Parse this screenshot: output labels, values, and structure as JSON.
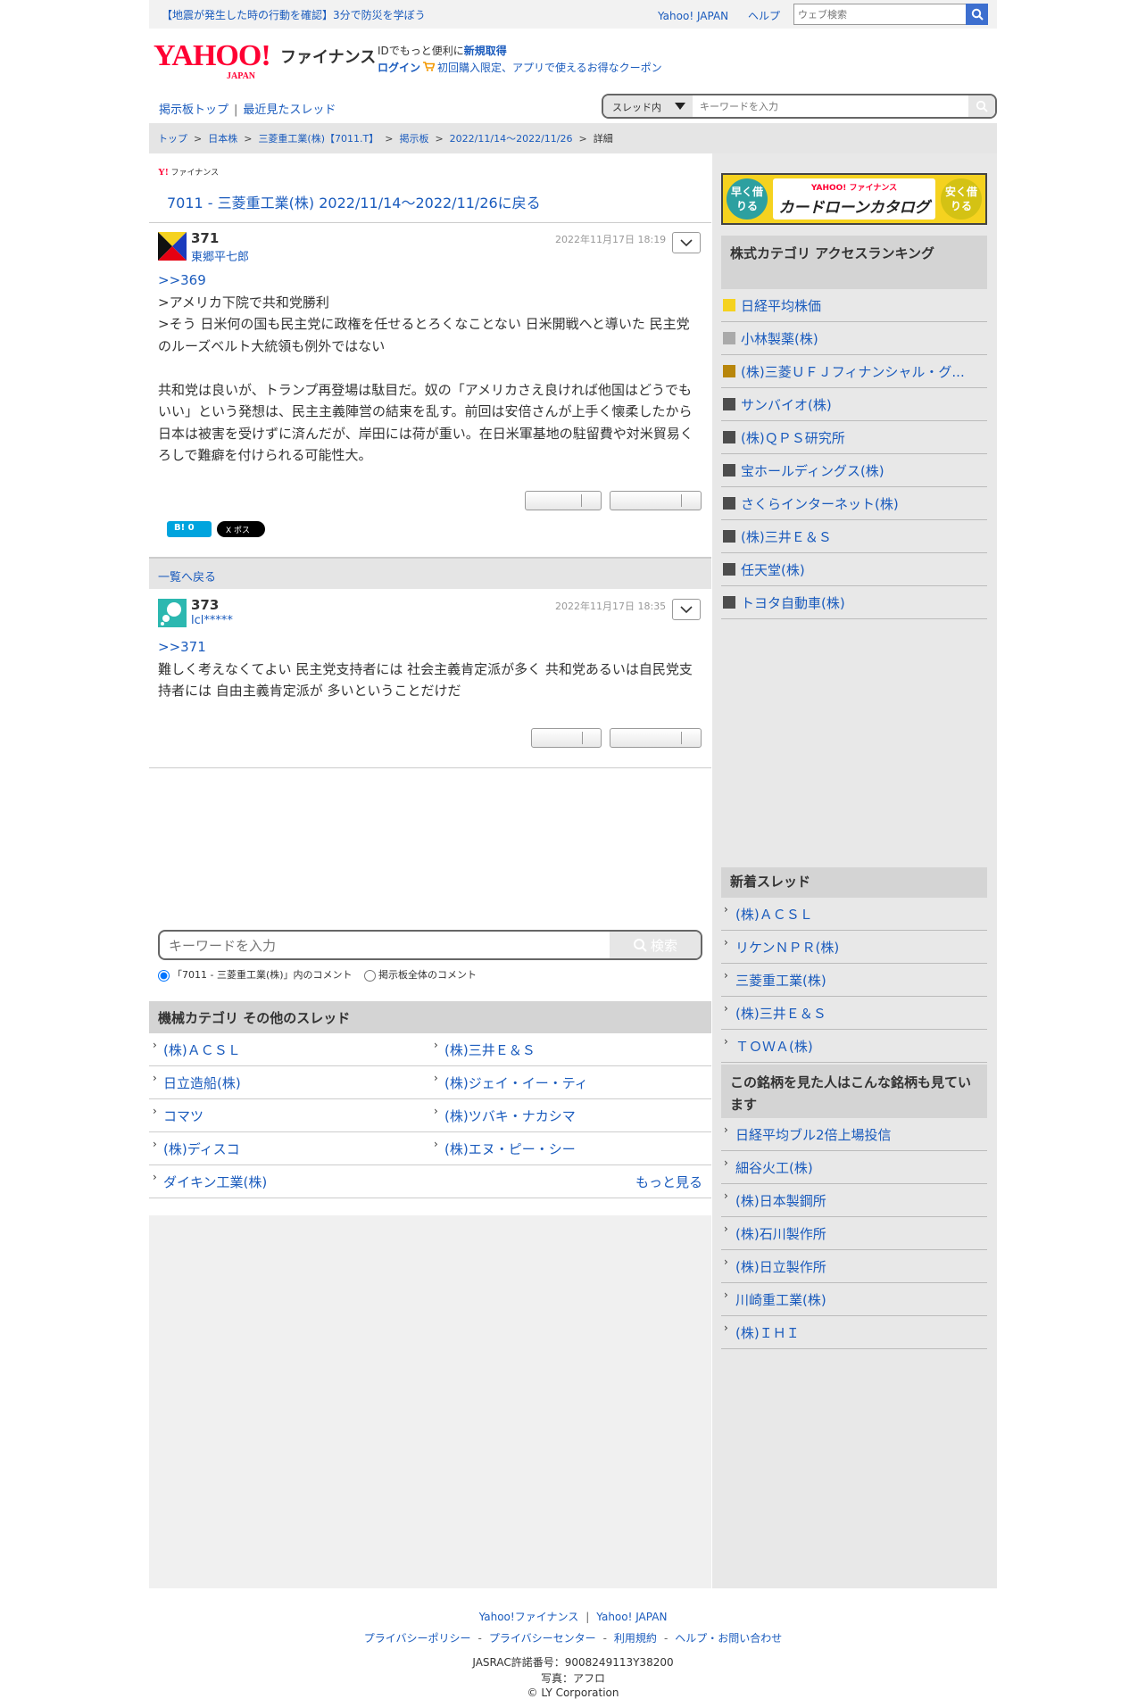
{
  "topbar": {
    "notice": "【地震が発生した時の行動を確認】3分で防災を学ぼう",
    "yahoo_japan": "Yahoo! JAPAN",
    "help": "ヘルプ",
    "search_placeholder": "ウェブ検索"
  },
  "header": {
    "logo_text": "YAHOO!",
    "logo_sub": "JAPAN",
    "service_name": "ファイナンス",
    "id_line_prefix": "IDでもっと便利に",
    "register": "新規取得",
    "login": "ログイン",
    "coupon": "初回購入限定、アプリで使えるお得なクーポン"
  },
  "nav": {
    "board_top": "掲示板トップ",
    "recent": "最近見たスレッド",
    "scope_select": "スレッド内",
    "keyword_placeholder": "キーワードを入力"
  },
  "breadcrumb": [
    "トップ",
    "日本株",
    "三菱重工業(株)【7011.T】",
    "掲示板",
    "2022/11/14〜2022/11/26",
    "詳細"
  ],
  "thread": {
    "source": "ファイナンス",
    "back_link": "7011 - 三菱重工業(株) 2022/11/14〜2022/11/26に戻る"
  },
  "posts": [
    {
      "number": "371",
      "user": "東郷平七郎",
      "date": "2022年11月17日 18:19",
      "ref": ">>369",
      "lines": [
        ">アメリカ下院で共和党勝利",
        ">そう 日米何の国も民主党に政権を任せるとろくなことない 日米開戦へと導いた 民主党のルーズベルト大統領も例外ではない",
        "",
        "共和党は良いが、トランプ再登場は駄目だ。奴の「アメリカさえ良ければ他国はどうでもいい」という発想は、民主主義陣営の結束を乱す。前回は安倍さんが上手く懐柔したから日本は被害を受けずに済んだが、岸田には荷が重い。在日米軍基地の駐留費や対米貿易くろしで難癖を付けられる可能性大。"
      ]
    },
    {
      "number": "373",
      "user": "lcl*****",
      "date": "2022年11月17日 18:35",
      "ref": ">>371",
      "lines": [
        "難しく考えなくてよい 民主党支持者には 社会主義肯定派が多く 共和党あるいは自民党支持者には 自由主義肯定派が 多いということだけだ"
      ]
    }
  ],
  "share": {
    "hatena": "B! 0",
    "x": "X ポスト"
  },
  "list_back": "一覧へ戻る",
  "bottom_search": {
    "placeholder": "キーワードを入力",
    "button": "検索",
    "radio_thread": "「7011 - 三菱重工業(株)」内のコメント",
    "radio_all": "掲示板全体のコメント"
  },
  "other_threads": {
    "title": "機械カテゴリ その他のスレッド",
    "items": [
      "(株)ＡＣＳＬ",
      "(株)三井Ｅ＆Ｓ",
      "日立造船(株)",
      "(株)ジェイ・イー・ティ",
      "コマツ",
      "(株)ツバキ・ナカシマ",
      "(株)ディスコ",
      "(株)エヌ・ピー・シー",
      "ダイキン工業(株)"
    ],
    "more": "もっと見る"
  },
  "sidebar": {
    "ad": {
      "left": "早く借りる",
      "brand": "YAHOO! ファイナンス",
      "title": "カードローンカタログ",
      "right": "安く借りる"
    },
    "ranking_title": "株式カテゴリ アクセスランキング",
    "ranking": [
      {
        "name": "日経平均株価",
        "color": "#f5d21f"
      },
      {
        "name": "小林製薬(株)",
        "color": "#aaaaaa"
      },
      {
        "name": "(株)三菱ＵＦＪフィナンシャル・グ...",
        "color": "#b8860b"
      },
      {
        "name": "サンバイオ(株)",
        "color": "#4d4d4d"
      },
      {
        "name": "(株)ＱＰＳ研究所",
        "color": "#4d4d4d"
      },
      {
        "name": "宝ホールディングス(株)",
        "color": "#4d4d4d"
      },
      {
        "name": "さくらインターネット(株)",
        "color": "#4d4d4d"
      },
      {
        "name": "(株)三井Ｅ＆Ｓ",
        "color": "#4d4d4d"
      },
      {
        "name": "任天堂(株)",
        "color": "#4d4d4d"
      },
      {
        "name": "トヨタ自動車(株)",
        "color": "#4d4d4d"
      }
    ],
    "new_threads_title": "新着スレッド",
    "new_threads": [
      "(株)ＡＣＳＬ",
      "リケンＮＰＲ(株)",
      "三菱重工業(株)",
      "(株)三井Ｅ＆Ｓ",
      "ＴＯＷＡ(株)"
    ],
    "also_viewed_title": "この銘柄を見た人はこんな銘柄も見ています",
    "also_viewed": [
      "日経平均ブル2倍上場投信",
      "細谷火工(株)",
      "(株)日本製鋼所",
      "(株)石川製作所",
      "(株)日立製作所",
      "川崎重工業(株)",
      "(株)ＩＨＩ"
    ]
  },
  "footer": {
    "yahoo_finance": "Yahoo!ファイナンス",
    "yahoo_japan": "Yahoo! JAPAN",
    "privacy_policy": "プライバシーポリシー",
    "privacy_center": "プライバシーセンター",
    "terms": "利用規約",
    "help": "ヘルプ・お問い合わせ",
    "jasrac": "JASRAC許諾番号：9008249113Y38200",
    "photo": "写真：アフロ",
    "copyright": "© LY Corporation"
  }
}
